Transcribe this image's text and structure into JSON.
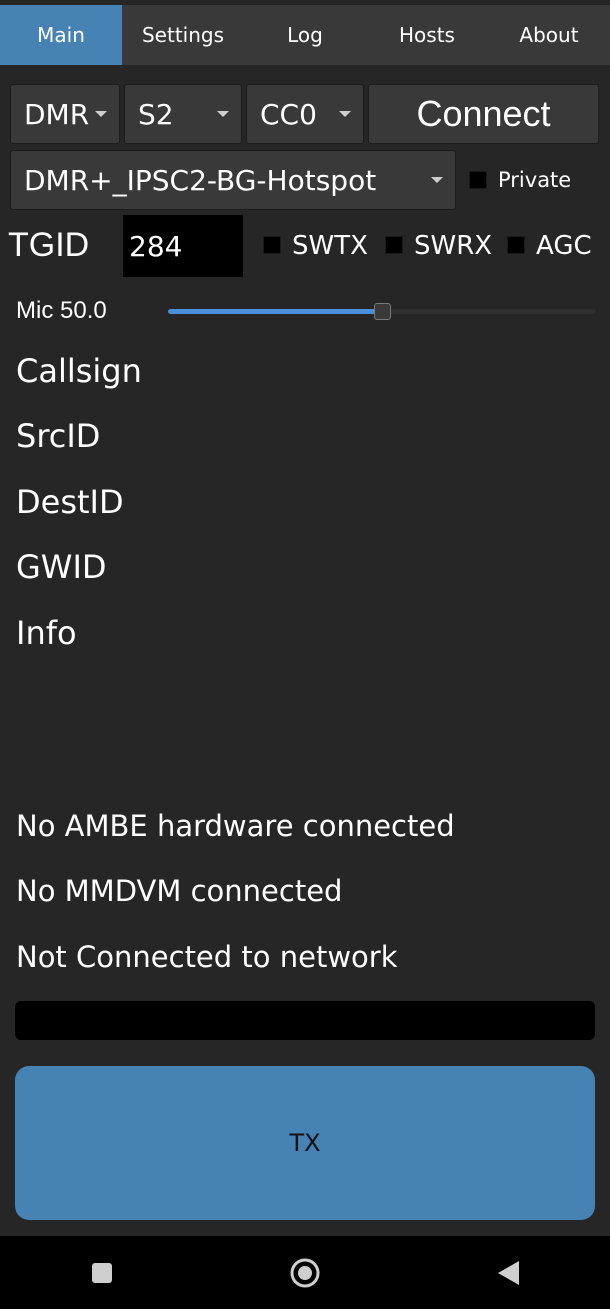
{
  "tabs": [
    {
      "label": "Main",
      "active": true
    },
    {
      "label": "Settings",
      "active": false
    },
    {
      "label": "Log",
      "active": false
    },
    {
      "label": "Hosts",
      "active": false
    },
    {
      "label": "About",
      "active": false
    }
  ],
  "controls": {
    "mode": "DMR",
    "slot": "S2",
    "color_code": "CC0",
    "connect_label": "Connect",
    "host": "DMR+_IPSC2-BG-Hotspot",
    "private_label": "Private",
    "private_checked": false,
    "tgid_label": "TGID",
    "tgid_value": "284",
    "swtx_label": "SWTX",
    "swrx_label": "SWRX",
    "agc_label": "AGC",
    "mic_label": "Mic 50.0",
    "mic_level": 0.5
  },
  "info": {
    "callsign": "Callsign",
    "srcid": "SrcID",
    "destid": "DestID",
    "gwid": "GWID",
    "info": "Info"
  },
  "status": {
    "ambe": "No AMBE hardware connected",
    "mmdvm": "No MMDVM connected",
    "network": "Not Connected to network"
  },
  "progress_level": 0,
  "tx_label": "TX",
  "icons": {
    "recents": "square-icon",
    "home": "circle-icon",
    "back": "triangle-icon"
  },
  "colors": {
    "accent": "#4682b4",
    "background": "#262626",
    "navbar": "#000000"
  }
}
